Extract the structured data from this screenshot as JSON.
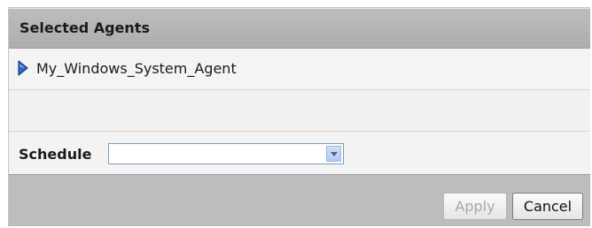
{
  "selected_agents": {
    "title": "Selected Agents",
    "items": [
      {
        "label": "My_Windows_System_Agent",
        "icon": "blue-arrow-icon"
      }
    ]
  },
  "schedule": {
    "label": "Schedule",
    "value": ""
  },
  "buttons": {
    "apply": "Apply",
    "cancel": "Cancel"
  },
  "colors": {
    "header_bg": "#b5b5b5",
    "arrow_icon": "#2f63c8",
    "footer_bg": "#bdbdbd"
  }
}
